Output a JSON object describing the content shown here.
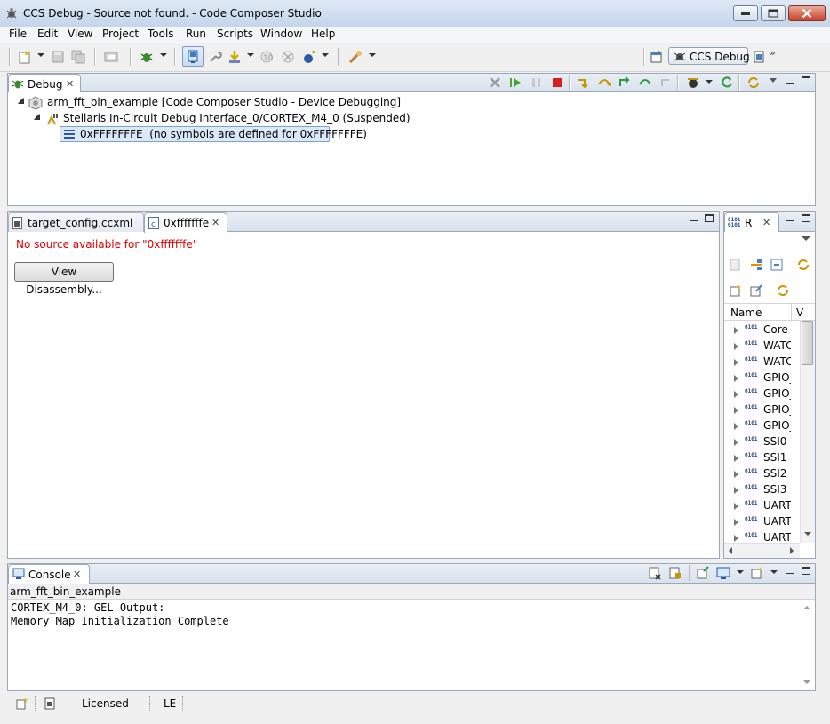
{
  "window": {
    "title": "CCS Debug - Source not found. - Code Composer Studio"
  },
  "menu": [
    "File",
    "Edit",
    "View",
    "Project",
    "Tools",
    "Run",
    "Scripts",
    "Window",
    "Help"
  ],
  "perspective": {
    "active_label": "CCS Debug",
    "more_label": "»"
  },
  "debug_view": {
    "tab_label": "Debug",
    "tree": {
      "launch": "arm_fft_bin_example [Code Composer Studio - Device Debugging]",
      "target": "Stellaris In-Circuit Debug Interface_0/CORTEX_M4_0 (Suspended)",
      "frame": "0xFFFFFFFE  (no symbols are defined for 0xFFFFFFFE)"
    }
  },
  "editor": {
    "tabs": [
      {
        "label": "target_config.ccxml",
        "active": false
      },
      {
        "label": "0xfffffffe",
        "active": true
      }
    ],
    "message": "No source available for \"0xfffffffe\"",
    "button_label": "View Disassembly..."
  },
  "registers_view": {
    "tab_label": "R",
    "column_name": "Name",
    "column_value_abbrev": "V",
    "rows": [
      "Core I",
      "WATC",
      "WATC",
      "GPIO_",
      "GPIO_",
      "GPIO_",
      "GPIO_",
      "SSI0",
      "SSI1",
      "SSI2",
      "SSI3",
      "UART",
      "UART",
      "UART"
    ],
    "icon_text": "0101"
  },
  "console_view": {
    "tab_label": "Console",
    "session": "arm_fft_bin_example",
    "lines": [
      "CORTEX_M4_0: GEL Output:",
      "Memory Map Initialization Complete"
    ]
  },
  "status_bar": {
    "license": "Licensed",
    "mode": "LE"
  }
}
